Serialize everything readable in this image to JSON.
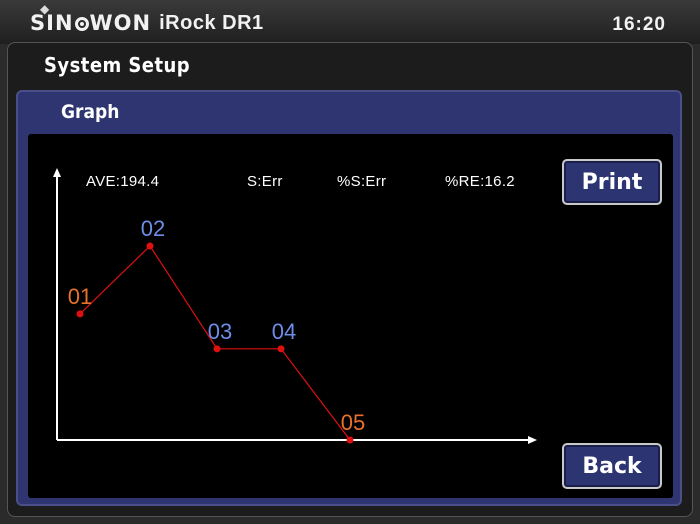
{
  "header": {
    "brand": "SINOWON",
    "model": "iRock DR1",
    "time": "16:20"
  },
  "page_title": "System Setup",
  "panel_title": "Graph",
  "stats": {
    "ave": "AVE:194.4",
    "s": "S:Err",
    "pct_s": "%S:Err",
    "pct_re": "%RE:16.2"
  },
  "buttons": {
    "print": "Print",
    "back": "Back"
  },
  "chart_data": {
    "type": "line",
    "x": [
      "01",
      "02",
      "03",
      "04",
      "05"
    ],
    "values": [
      0.65,
      1.0,
      0.47,
      0.47,
      0.0
    ],
    "point_label_colors": [
      "#e8722c",
      "#6d8ee8",
      "#6d8ee8",
      "#6d8ee8",
      "#e8722c"
    ],
    "line_color": "#e01010",
    "axis_color": "#ffffff"
  }
}
